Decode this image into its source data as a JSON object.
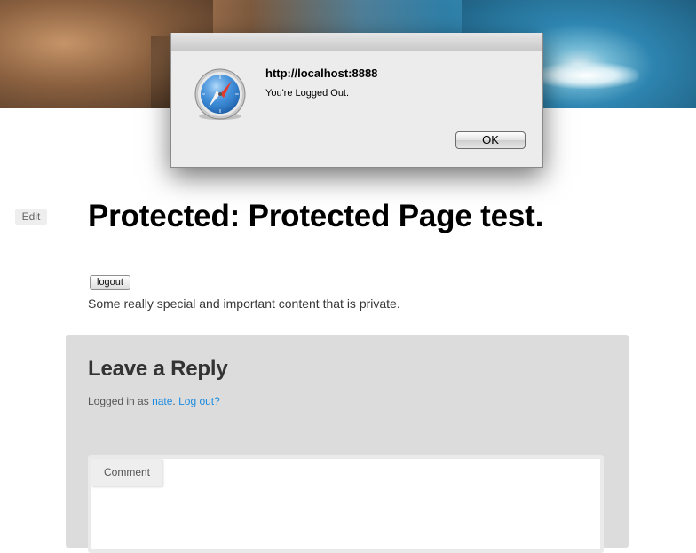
{
  "alert": {
    "title": "http://localhost:8888",
    "message": "You're Logged Out.",
    "ok_label": "OK"
  },
  "post": {
    "edit_label": "Edit",
    "title": "Protected: Protected Page test.",
    "logout_label": "logout",
    "content": "Some really special and important content that is private."
  },
  "comments": {
    "heading": "Leave a Reply",
    "logged_in_prefix": "Logged in as ",
    "username": "nate",
    "separator": ". ",
    "logout_link": "Log out?",
    "comment_label": "Comment"
  },
  "colors": {
    "link": "#1b8be0",
    "reply_bg": "#dcdcdc"
  }
}
